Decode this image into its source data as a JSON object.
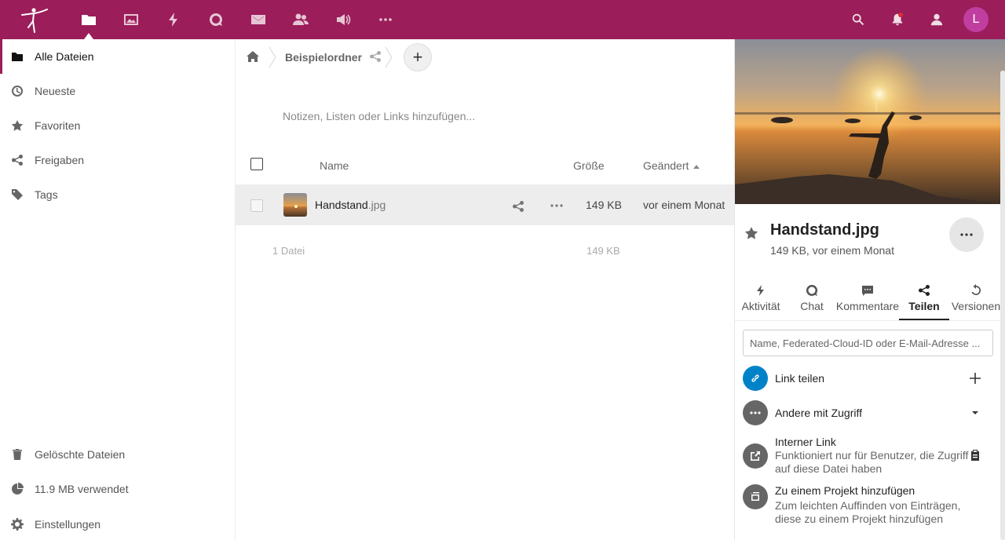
{
  "colors": {
    "header": "#9b1d5a",
    "avatar": "#c03ea0",
    "link_share": "#0082c9",
    "others": "#666666"
  },
  "header": {
    "apps": [
      {
        "name": "files-app-icon",
        "active": true
      },
      {
        "name": "photos-app-icon",
        "active": false
      },
      {
        "name": "activity-app-icon",
        "active": false
      },
      {
        "name": "talk-app-icon",
        "active": false
      },
      {
        "name": "mail-app-icon",
        "active": false
      },
      {
        "name": "contacts-app-icon",
        "active": false
      },
      {
        "name": "announcements-app-icon",
        "active": false
      },
      {
        "name": "more-apps-icon",
        "active": false
      }
    ],
    "avatar_initial": "L"
  },
  "sidebar": {
    "items": [
      {
        "label": "Alle Dateien",
        "icon": "folder-icon"
      },
      {
        "label": "Neueste",
        "icon": "clock-icon"
      },
      {
        "label": "Favoriten",
        "icon": "star-icon"
      },
      {
        "label": "Freigaben",
        "icon": "share-icon"
      },
      {
        "label": "Tags",
        "icon": "tag-icon"
      }
    ],
    "deleted": "Gelöschte Dateien",
    "quota": "11.9 MB verwendet",
    "settings": "Einstellungen"
  },
  "breadcrumb": {
    "folder": "Beispielordner",
    "add": "+"
  },
  "notes_placeholder": "Notizen, Listen oder Links hinzufügen...",
  "table": {
    "headers": {
      "name": "Name",
      "size": "Größe",
      "modified": "Geändert"
    },
    "rows": [
      {
        "basename": "Handstand",
        "ext": ".jpg",
        "size": "149 KB",
        "modified": "vor einem Monat"
      }
    ],
    "summary": {
      "count": "1 Datei",
      "size": "149 KB"
    }
  },
  "details": {
    "title": "Handstand.jpg",
    "subtitle": "149 KB, vor einem Monat",
    "tabs": [
      {
        "label": "Aktivität",
        "icon": "activity-icon"
      },
      {
        "label": "Chat",
        "icon": "chat-icon"
      },
      {
        "label": "Kommentare",
        "icon": "comment-icon"
      },
      {
        "label": "Teilen",
        "icon": "share-icon"
      },
      {
        "label": "Versionen",
        "icon": "history-icon"
      }
    ],
    "active_tab": "Teilen",
    "share_placeholder": "Name, Federated-Cloud-ID oder E-Mail-Adresse ...",
    "link_share": "Link teilen",
    "others_access": "Andere mit Zugriff",
    "internal_link": {
      "title": "Interner Link",
      "desc": "Funktioniert nur für Benutzer, die Zugriff auf diese Datei haben"
    },
    "project": {
      "title": "Zu einem Projekt hinzufügen",
      "desc": "Zum leichten Auffinden von Einträgen, diese zu einem Projekt hinzufügen"
    }
  }
}
